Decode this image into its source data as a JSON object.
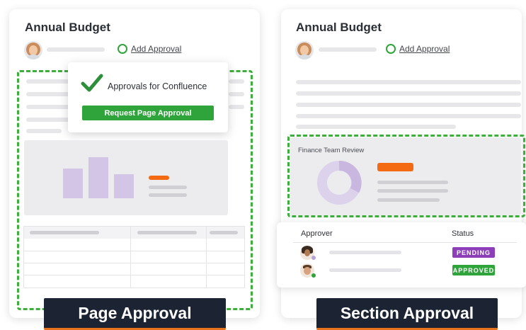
{
  "left_card": {
    "title": "Annual Budget",
    "add_approval": "Add Approval",
    "popup": {
      "heading": "Approvals for Confluence",
      "button": "Request Page Approval"
    },
    "caption": "Page Approval"
  },
  "right_card": {
    "title": "Annual Budget",
    "add_approval": "Add Approval",
    "section_label": "Finance Team Review",
    "table": {
      "headers": [
        "Approver",
        "Status"
      ],
      "rows": [
        {
          "status": "PENDING",
          "status_color": "#8c3fb8"
        },
        {
          "status": "APPROVED",
          "status_color": "#2ea43a"
        }
      ]
    },
    "caption": "Section Approval"
  },
  "colors": {
    "accent_green": "#2ea43a",
    "accent_orange": "#f36a12",
    "caption_bg": "#1c2433",
    "chart_purple": "#d3c5e6"
  },
  "icons": [
    "add-approval-circle-icon",
    "checkmark-icon",
    "donut-chart-icon",
    "avatar-icon"
  ]
}
